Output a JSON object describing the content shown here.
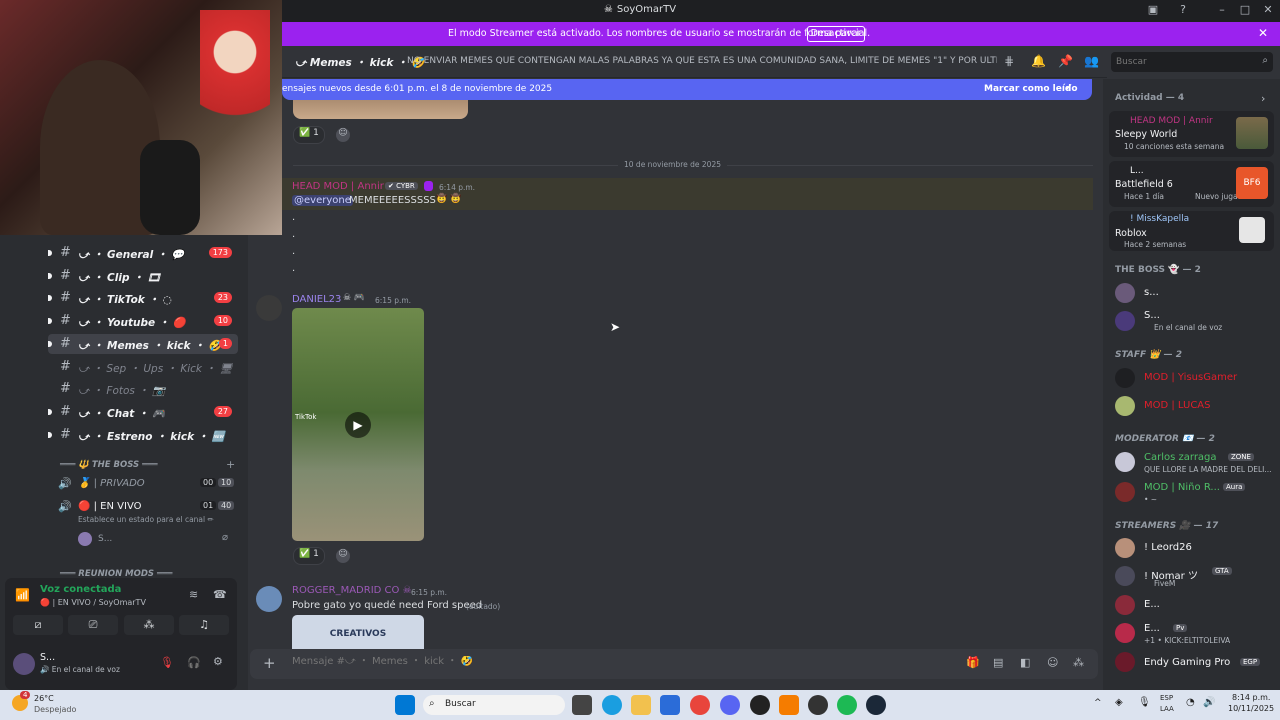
{
  "window": {
    "title": "SoyOmarTV"
  },
  "streamer_bar": {
    "text": "El modo Streamer está activado. Los nombres de usuario se mostrarán de forma parcial.",
    "button": "Desactivar"
  },
  "header": {
    "channel": "⤻ Memes ・ kick ・ 🤣",
    "topic": "NO ENVIAR MEMES QUE CONTENGAN MALAS PALABRAS YA QUE ESTA ES UNA COMUNIDAD SANA, LIMITE DE MEMES \"1\" Y POR ULTIMO EL ...",
    "search_placeholder": "Buscar"
  },
  "banner": {
    "text": "ensajes nuevos desde 6:01 p.m. el 8 de noviembre de 2025",
    "action": "Marcar como leído"
  },
  "sidebar": {
    "channels": [
      {
        "name": "⤻ ・ General ・ 💬",
        "badge": "173"
      },
      {
        "name": "⤻ ・ Clip ・ 🎞",
        "badge": ""
      },
      {
        "name": "⤻ ・ TikTok ・ ◌",
        "badge": "23"
      },
      {
        "name": "⤻ ・ Youtube ・ 🔴",
        "badge": "10"
      },
      {
        "name": "⤻ ・ Memes ・ kick ・ 🤣",
        "badge": "1"
      },
      {
        "name": "⤻ ・ Sep ・ Ups ・ Kick ・ 🖥",
        "badge": ""
      },
      {
        "name": "⤻ ・ Fotos ・ 📷",
        "badge": ""
      },
      {
        "name": "⤻ ・ Chat ・ 🎮",
        "badge": "27"
      },
      {
        "name": "⤻ ・ Estreno ・ kick ・ 🆕",
        "badge": ""
      }
    ],
    "boss_category": "═══ 🔱 THE BOSS ═══",
    "voice_channels": [
      {
        "name": "🥇 | PRIVADO",
        "count_a": "00",
        "count_b": "10"
      },
      {
        "name": "🔴 | EN VIVO",
        "count_a": "01",
        "count_b": "40"
      }
    ],
    "status_prompt": "Establece un estado para el canal ✏",
    "voice_user": "S...",
    "reunion_category": "═══ REUNION MODS ═══"
  },
  "voice": {
    "status": "Voz conectada",
    "channel": "🔴 | EN VIVO / SoyOmarTV"
  },
  "user": {
    "name": "S...",
    "status": "🔊 En el canal de voz"
  },
  "messages": {
    "date_divider": "10 de noviembre de 2025",
    "reaction_count": "1",
    "m1": {
      "author": "HEAD MOD | Annir",
      "tag": "CYBR",
      "time": "6:14 p.m.",
      "mention": "@everyone",
      "text": "MEMEEEEESSSSS"
    },
    "m2": {
      "author": "DANIEL23",
      "time": "6:15 p.m.",
      "video_label": "TikTok"
    },
    "m3": {
      "author": "ROGGER_MADRID",
      "suffix": "CO",
      "time": "6:15 p.m.",
      "text": "Pobre gato yo quedé need Ford speed",
      "edited": "(editado)",
      "image_text": "CREATIVOS"
    }
  },
  "composer": {
    "placeholder": "Mensaje #⤻ ・ Memes ・ kick ・ 🤣"
  },
  "members": {
    "activity_label": "Actividad — 4",
    "activities": [
      {
        "name": "HEAD MOD | Annir",
        "game": "Sleepy World",
        "detail": "10 canciones esta semana"
      },
      {
        "name": "L...",
        "game": "Battlefield 6",
        "detail": "Hace 1 día",
        "extra": "Nuevo jugador"
      },
      {
        "name": "! MissKapella",
        "game": "Roblox",
        "detail": "Hace 2 semanas"
      }
    ],
    "groups": [
      {
        "title": "THE BOSS 👻 — 2",
        "members": [
          {
            "name": "s...",
            "sub": ""
          },
          {
            "name": "S...",
            "sub": "En el canal de voz"
          }
        ]
      },
      {
        "title": "STAFF 👑 — 2",
        "members": [
          {
            "name": "MOD | YisusGamer",
            "sub": ""
          },
          {
            "name": "MOD | LUCAS",
            "sub": ""
          }
        ]
      },
      {
        "title": "MODERATOR 📧 — 2",
        "members": [
          {
            "name": "Carlos zarraga",
            "tag": "ZONE",
            "sub": "QUE LLORE LA MADRE DEL DELI..."
          },
          {
            "name": "MOD | Niño R...",
            "tag": "Aura",
            "sub": "• ~"
          }
        ]
      },
      {
        "title": "STREAMERS 🎥 — 17",
        "members": [
          {
            "name": "! Leord26",
            "sub": ""
          },
          {
            "name": "! Nomar ツ",
            "tag": "GTA",
            "sub": "FiveM"
          },
          {
            "name": "E...",
            "sub": ""
          },
          {
            "name": "E...",
            "tag": "Pv",
            "sub": "+1 • KICK:ELTITOLEIVA"
          },
          {
            "name": "Endy Gaming Pro",
            "tag": "EGP",
            "sub": ""
          }
        ]
      }
    ]
  },
  "taskbar": {
    "weather_temp": "26°C",
    "weather_desc": "Despejado",
    "search": "Buscar",
    "lang": "ESP",
    "lang2": "LAA",
    "time": "8:14 p.m.",
    "date": "10/11/2025",
    "badge": "4"
  },
  "colors": {
    "accent": "#5865f2",
    "streamer": "#9b22ef",
    "danger": "#f23f43",
    "green": "#23a55a"
  }
}
